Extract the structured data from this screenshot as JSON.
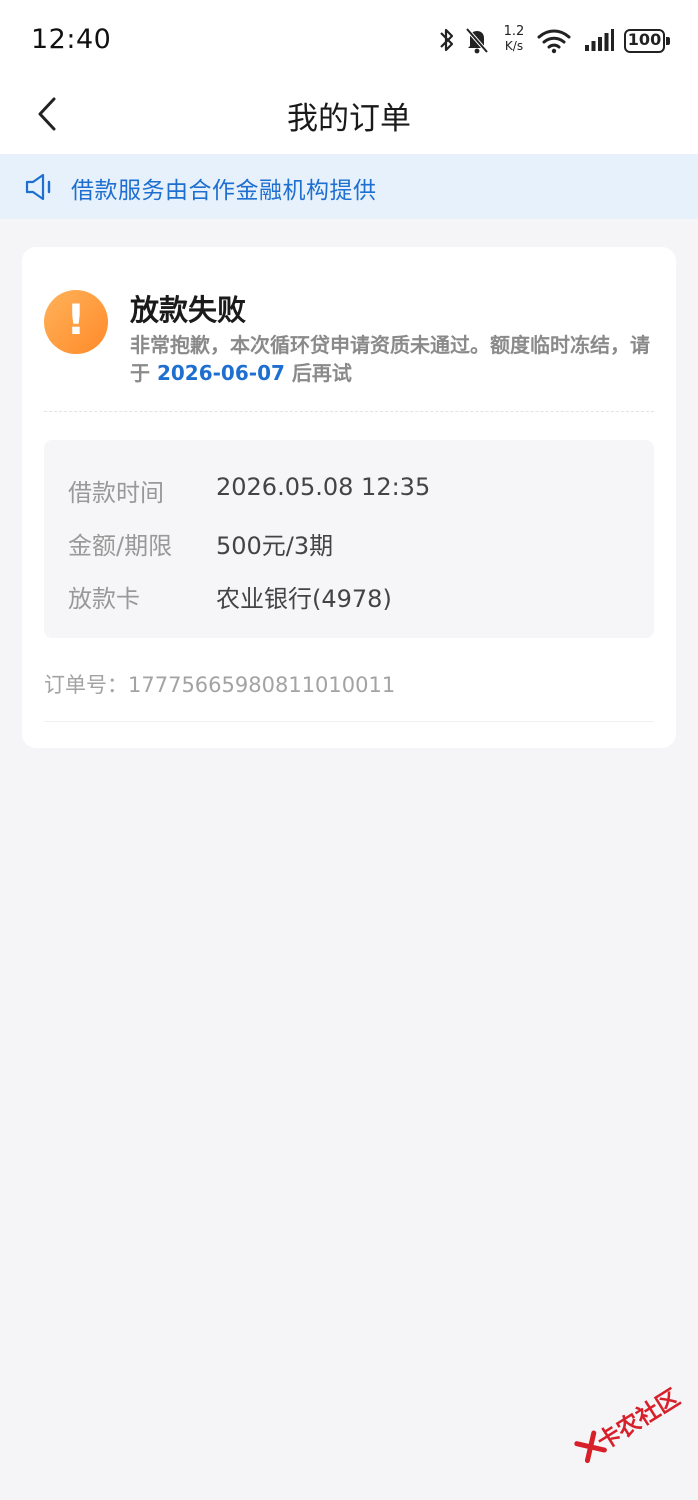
{
  "status_bar": {
    "time": "12:40",
    "network_speed_value": "1.2",
    "network_speed_unit": "K/s",
    "battery": "100",
    "icons": [
      "bluetooth-icon",
      "bell-muted-icon",
      "wifi-icon",
      "signal-icon",
      "battery-icon"
    ]
  },
  "nav": {
    "title": "我的订单",
    "back_icon": "chevron-left-icon"
  },
  "notice": {
    "icon": "speaker-icon",
    "text": "借款服务由合作金融机构提供"
  },
  "order": {
    "status_icon": "warning-icon",
    "status_title": "放款失败",
    "message_prefix": "非常抱歉，本次循环贷申请资质未通过。额度临时冻结，请于 ",
    "retry_date": "2026-06-07",
    "message_suffix": " 后再试",
    "details": [
      {
        "label": "借款时间",
        "value": "2026.05.08 12:35"
      },
      {
        "label": "金额/期限",
        "value": "500元/3期"
      },
      {
        "label": "放款卡",
        "value": "农业银行(4978)"
      }
    ],
    "order_number": "订单号：1777566598081101001​1"
  },
  "watermark": {
    "text": "卡农社区"
  },
  "colors": {
    "accent_blue": "#1e6fd0",
    "notice_bg": "#e6f1fc",
    "warning_orange": "#ff9a3c",
    "page_bg": "#f5f5f7",
    "watermark_red": "#d8202a"
  }
}
